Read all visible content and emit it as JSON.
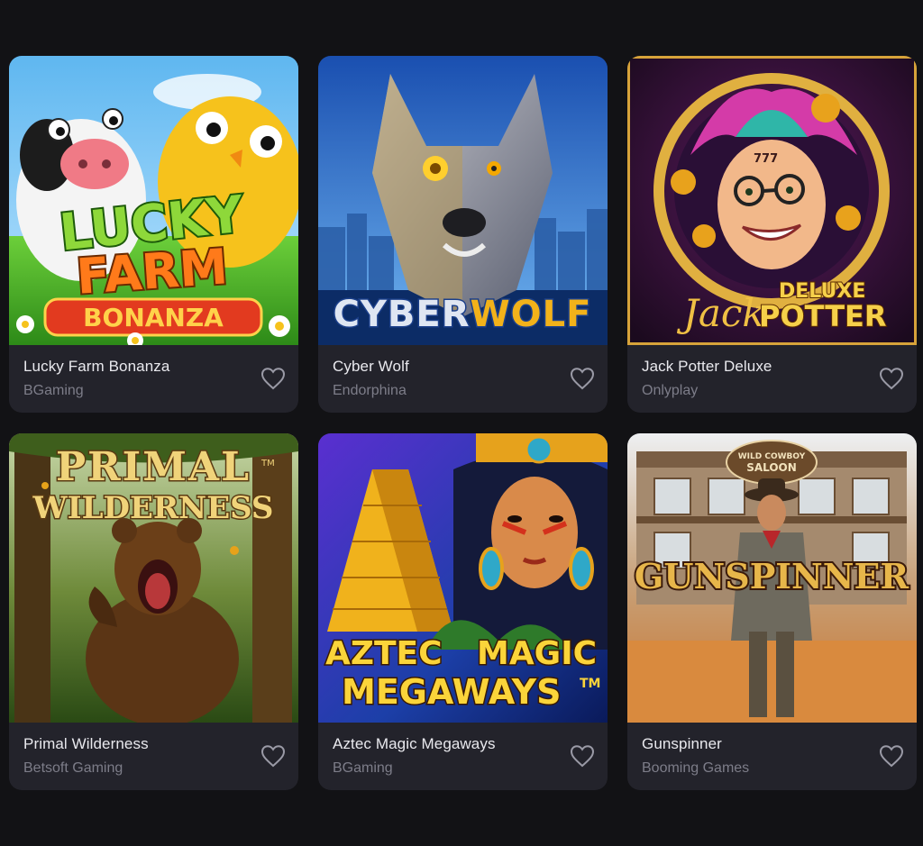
{
  "games": [
    {
      "title": "Lucky Farm Bonanza",
      "provider": "BGaming",
      "art": {
        "line1": "LUCKY",
        "line2": "FARM",
        "line3": "BONANZA"
      }
    },
    {
      "title": "Cyber Wolf",
      "provider": "Endorphina",
      "art": {
        "line1": "CYBER",
        "line2": "WOLF"
      }
    },
    {
      "title": "Jack Potter Deluxe",
      "provider": "Onlyplay",
      "art": {
        "line1": "Jack",
        "line2": "DELUXE",
        "line3": "POTTER",
        "badge": "777"
      }
    },
    {
      "title": "Primal Wilderness",
      "provider": "Betsoft Gaming",
      "art": {
        "line1": "PRIMAL",
        "line2": "WILDERNESS",
        "tm": "TM"
      }
    },
    {
      "title": "Aztec Magic Megaways",
      "provider": "BGaming",
      "art": {
        "line1": "AZTEC",
        "line2": "MAGIC",
        "line3": "MEGAWAYS",
        "tm": "TM"
      }
    },
    {
      "title": "Gunspinner",
      "provider": "Booming Games",
      "art": {
        "line1": "GUNSPINNER",
        "sign1": "WILD COWBOY",
        "sign2": "SALOON"
      }
    }
  ],
  "colors": {
    "page_bg": "#121215",
    "card_bg": "#23232b",
    "title_text": "#e9e9ee",
    "provider_text": "#7d7d89",
    "heart_outline": "#9a9aa6"
  },
  "icons": {
    "favorite": "heart-outline-icon"
  }
}
